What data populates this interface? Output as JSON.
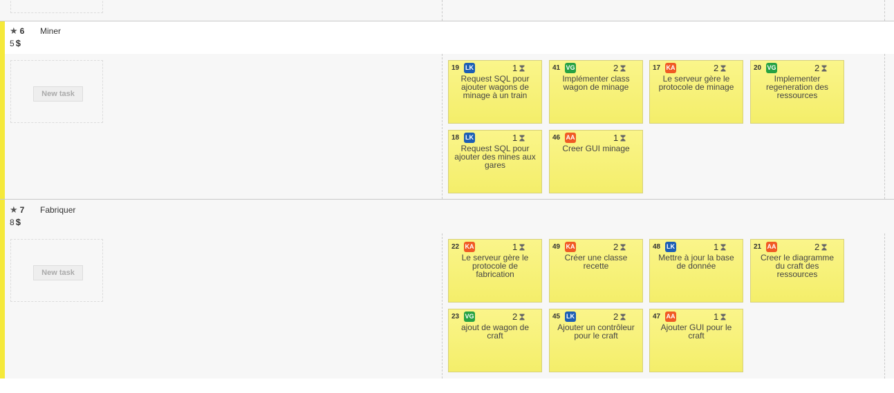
{
  "colors": {
    "accent_bar": "#f5e93a",
    "card_bg": "#f6f07a",
    "LK": "#1d5fb4",
    "VG": "#27a243",
    "KA": "#f05a24",
    "AA": "#f05a24"
  },
  "icons": {
    "story": "star-icon",
    "estimate": "hourglass-icon",
    "points": "dollar-icon"
  },
  "new_task_label": "New task",
  "stories": [
    {
      "id": "6",
      "title": "Miner",
      "points": "5",
      "tasks": [
        {
          "id": "19",
          "assignee": "LK",
          "estimate": "1",
          "title": "Request SQL pour ajouter wagons de minage à un train"
        },
        {
          "id": "41",
          "assignee": "VG",
          "estimate": "2",
          "title": "Implémenter class wagon de minage"
        },
        {
          "id": "17",
          "assignee": "KA",
          "estimate": "2",
          "title": "Le serveur gère le protocole de minage"
        },
        {
          "id": "20",
          "assignee": "VG",
          "estimate": "2",
          "title": "Implementer regeneration des ressources"
        },
        {
          "id": "18",
          "assignee": "LK",
          "estimate": "1",
          "title": "Request SQL pour ajouter des mines aux gares"
        },
        {
          "id": "46",
          "assignee": "AA",
          "estimate": "1",
          "title": "Creer GUI minage"
        }
      ]
    },
    {
      "id": "7",
      "title": "Fabriquer",
      "points": "8",
      "tasks": [
        {
          "id": "22",
          "assignee": "KA",
          "estimate": "1",
          "title": "Le serveur gère le protocole de fabrication"
        },
        {
          "id": "49",
          "assignee": "KA",
          "estimate": "2",
          "title": "Créer une classe recette"
        },
        {
          "id": "48",
          "assignee": "LK",
          "estimate": "1",
          "title": "Mettre à jour la base de donnée"
        },
        {
          "id": "21",
          "assignee": "AA",
          "estimate": "2",
          "title": "Creer le diagramme du craft des ressources"
        },
        {
          "id": "23",
          "assignee": "VG",
          "estimate": "2",
          "title": "ajout de wagon de craft"
        },
        {
          "id": "45",
          "assignee": "LK",
          "estimate": "2",
          "title": "Ajouter un contrôleur pour le craft"
        },
        {
          "id": "47",
          "assignee": "AA",
          "estimate": "1",
          "title": "Ajouter GUI pour le craft"
        }
      ]
    }
  ]
}
